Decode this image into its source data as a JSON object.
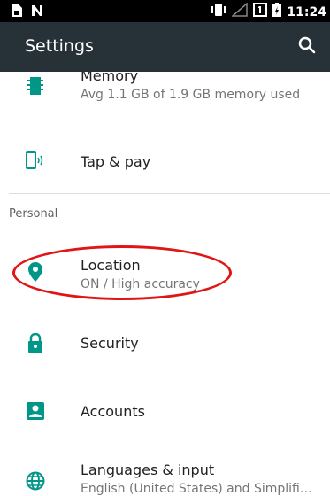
{
  "status_bar": {
    "time": "11:24",
    "icons": [
      "sim-icon",
      "nfc-n-icon",
      "vibrate-icon",
      "signal-icon",
      "sim-1-icon",
      "battery-icon"
    ]
  },
  "toolbar": {
    "title": "Settings",
    "search_icon": "search-icon"
  },
  "device_section": {
    "items": [
      {
        "title": "Memory",
        "summary": "Avg 1.1 GB of 1.9 GB memory used",
        "icon": "memory-chip-icon"
      },
      {
        "title": "Tap & pay",
        "summary": "",
        "icon": "tap-pay-icon"
      }
    ]
  },
  "personal_section": {
    "header": "Personal",
    "items": [
      {
        "title": "Location",
        "summary": "ON / High accuracy",
        "icon": "location-pin-icon"
      },
      {
        "title": "Security",
        "summary": "",
        "icon": "lock-icon"
      },
      {
        "title": "Accounts",
        "summary": "",
        "icon": "account-box-icon"
      },
      {
        "title": "Languages & input",
        "summary": "English (United States) and Simplifi…",
        "icon": "globe-icon"
      }
    ]
  },
  "colors": {
    "accent": "#009688",
    "toolbar": "#263238",
    "highlight": "#e01616"
  }
}
